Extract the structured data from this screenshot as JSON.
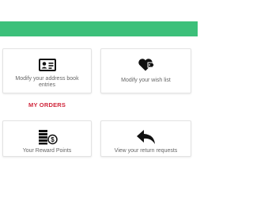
{
  "banner": {
    "color": "#3cc07a"
  },
  "cards": {
    "address_book": {
      "label": "Modify your address book entries",
      "icon": "address-card-icon"
    },
    "wishlist": {
      "label": "Modify your wish list",
      "icon": "heart-tag-icon"
    },
    "reward_points": {
      "label": "Your Reward Points",
      "icon": "money-coins-icon"
    },
    "return_requests": {
      "label": "View your return requests",
      "icon": "return-arrow-icon"
    }
  },
  "sections": {
    "my_orders": {
      "title": "MY ORDERS",
      "color": "#d0263b"
    }
  }
}
